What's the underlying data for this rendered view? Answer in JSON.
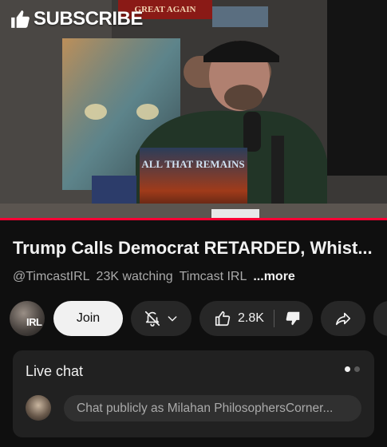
{
  "player": {
    "overlay_label": "SUBSCRIBE",
    "banner_text": "GREAT AGAIN",
    "book_text": "ALL THAT REMAINS",
    "progress_fraction": 1.0,
    "accent_color": "#ff0033"
  },
  "video": {
    "title": "Trump Calls Democrat RETARDED, Whist...",
    "channel_handle": "@TimcastIRL",
    "viewers": "23K watching",
    "channel_name": "Timcast IRL",
    "more_label": "...more"
  },
  "actions": {
    "avatar_text": "IRL",
    "join_label": "Join",
    "like_count": "2.8K",
    "icons": [
      "bell-off-icon",
      "chevron-down-icon",
      "thumb-up-icon",
      "thumb-down-icon",
      "share-icon"
    ]
  },
  "live_chat": {
    "title": "Live chat",
    "input_placeholder": "Chat publicly as Milahan PhilosophersCorner..."
  }
}
